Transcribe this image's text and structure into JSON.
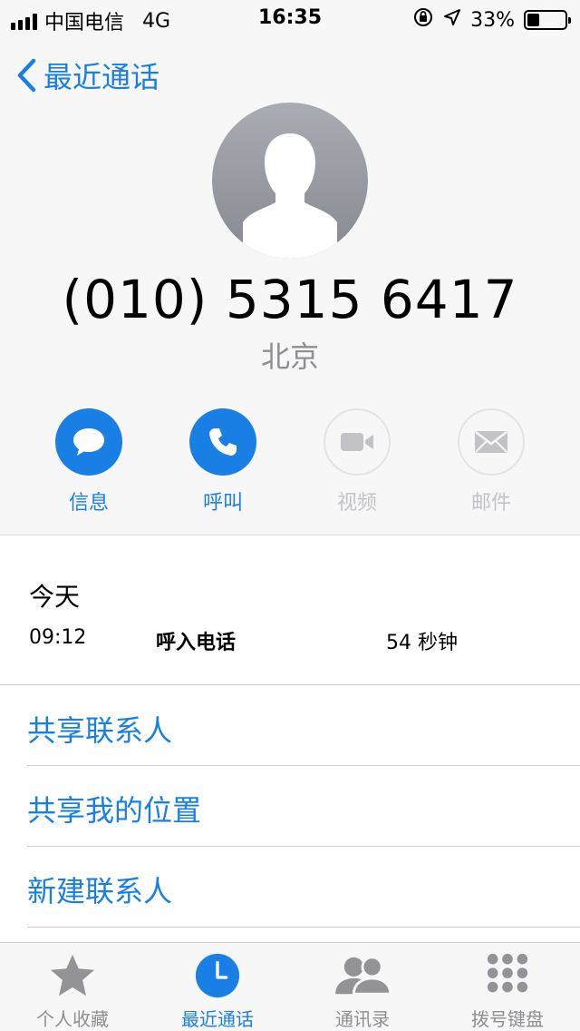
{
  "status_bar": {
    "carrier": "中国电信",
    "network": "4G",
    "time": "16:35",
    "battery": "33%",
    "battery_level": 0.33
  },
  "nav": {
    "back_label": "最近通话"
  },
  "contact": {
    "phone": "(010) 5315 6417",
    "location": "北京"
  },
  "actions": [
    {
      "label": "信息",
      "icon": "message-icon",
      "enabled": true
    },
    {
      "label": "呼叫",
      "icon": "phone-icon",
      "enabled": true
    },
    {
      "label": "视频",
      "icon": "video-icon",
      "enabled": false
    },
    {
      "label": "邮件",
      "icon": "mail-icon",
      "enabled": false
    }
  ],
  "call_log": {
    "date": "今天",
    "entries": [
      {
        "time": "09:12",
        "type": "呼入电话",
        "duration": "54 秒钟"
      }
    ]
  },
  "options": [
    {
      "label": "共享联系人"
    },
    {
      "label": "共享我的位置"
    },
    {
      "label": "新建联系人"
    }
  ],
  "tabs": [
    {
      "label": "个人收藏",
      "icon": "star-icon",
      "active": false
    },
    {
      "label": "最近通话",
      "icon": "clock-icon",
      "active": true
    },
    {
      "label": "通讯录",
      "icon": "contacts-icon",
      "active": false
    },
    {
      "label": "拨号键盘",
      "icon": "keypad-icon",
      "active": false
    }
  ],
  "colors": {
    "accent": "#1a7fe4",
    "disabled": "#c3c3c7",
    "secondary_text": "#8e8e93"
  }
}
